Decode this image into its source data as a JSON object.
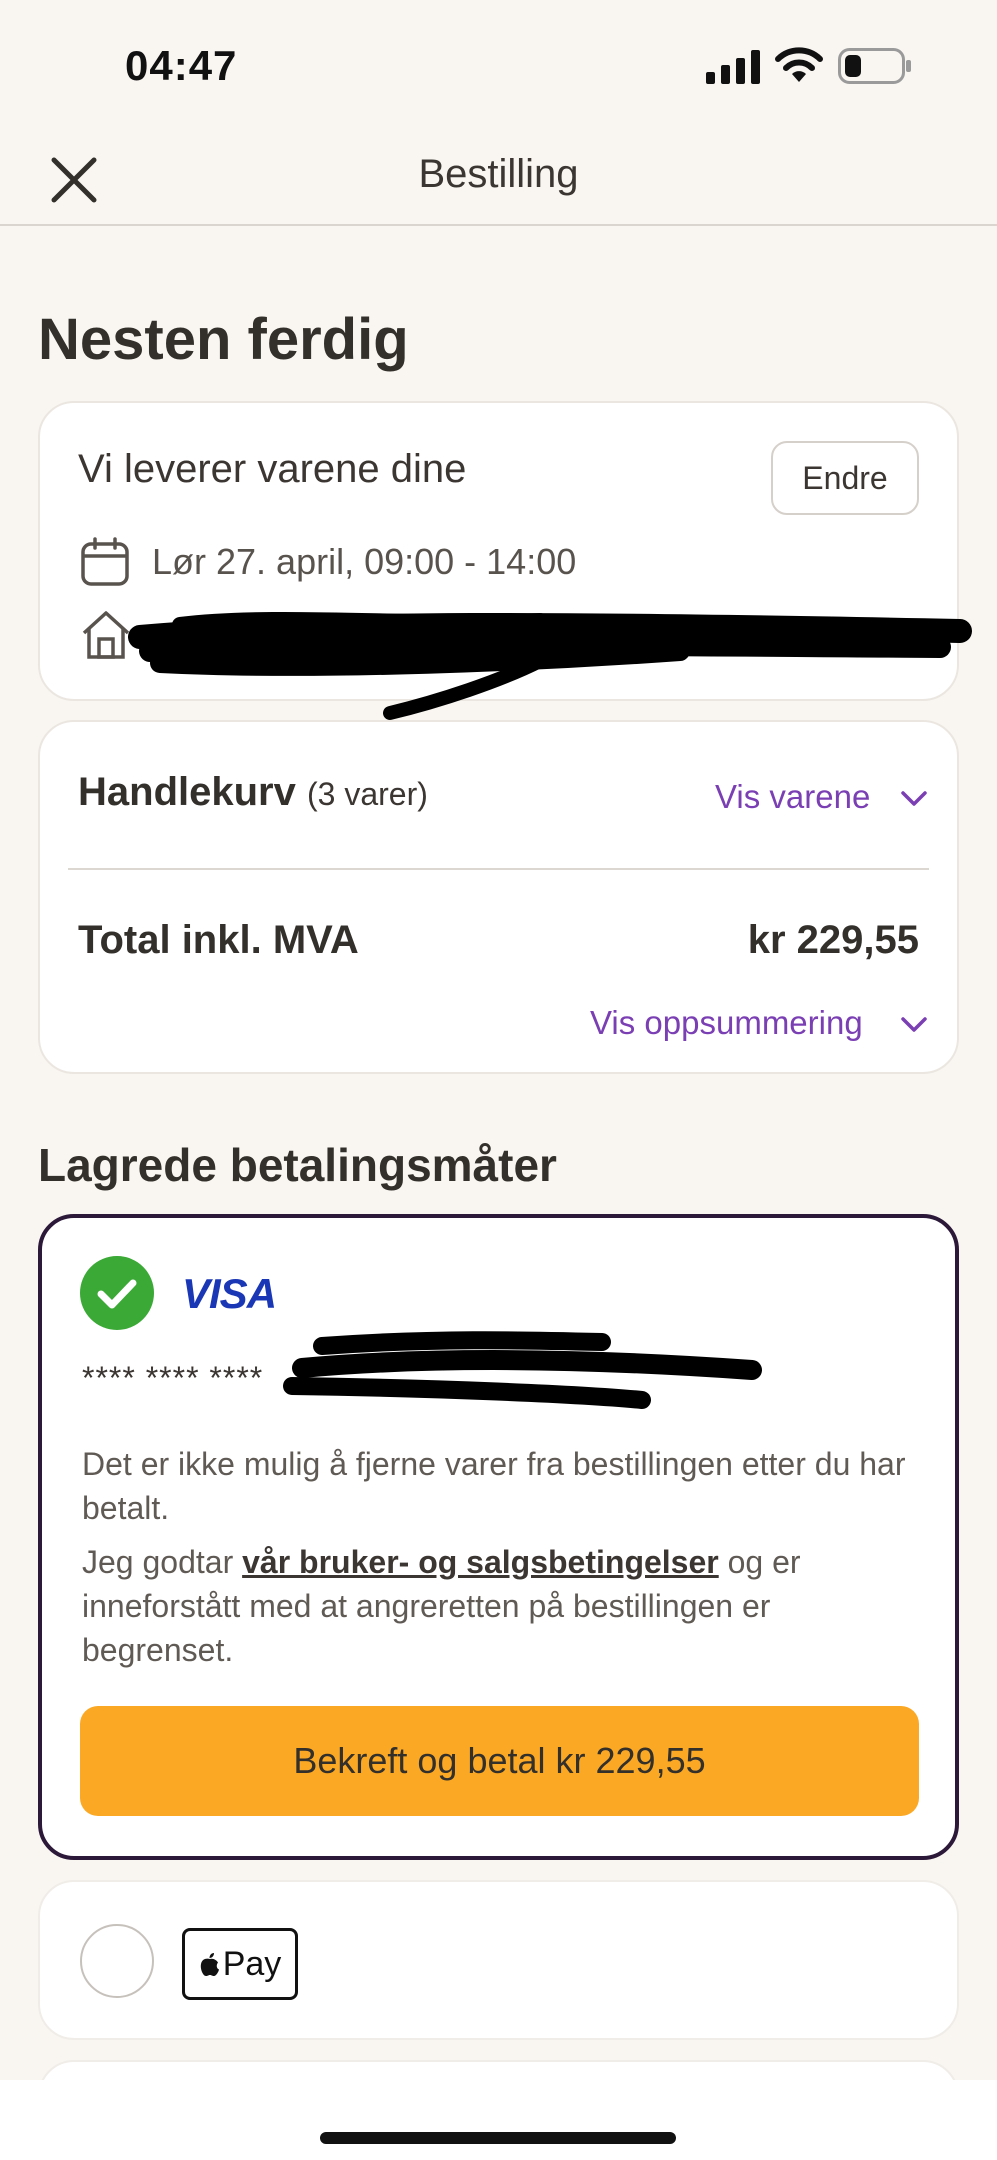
{
  "status_bar": {
    "time": "04:47"
  },
  "nav": {
    "title": "Bestilling"
  },
  "page_title": "Nesten ferdig",
  "delivery": {
    "title": "Vi leverer varene dine",
    "change_label": "Endre",
    "date": "Lør 27. april, 09:00 - 14:00"
  },
  "cart": {
    "title": "Handlekurv",
    "count": "(3 varer)",
    "show_items_label": "Vis varene",
    "total_label": "Total inkl. MVA",
    "total_amount": "kr 229,55",
    "show_summary_label": "Vis oppsummering"
  },
  "payment": {
    "section_title": "Lagrede betalingsmåter",
    "card_brand": "VISA",
    "card_mask": "**** **** ****",
    "info_text": "Det er ikke mulig å fjerne varer fra bestillingen etter du har betalt.",
    "terms_prefix": "Jeg godtar ",
    "terms_link": "vår bruker- og salgsbetingelser",
    "terms_suffix": " og er inneforstått med at angreretten på bestillingen er begrenset.",
    "confirm_label": "Bekreft og betal kr 229,55",
    "apple_pay_label": "Pay"
  },
  "colors": {
    "accent_purple": "#7b3fb4",
    "button_orange": "#fba824",
    "check_green": "#3aa935",
    "visa_blue": "#1a37b5",
    "selected_border": "#2c1838"
  }
}
